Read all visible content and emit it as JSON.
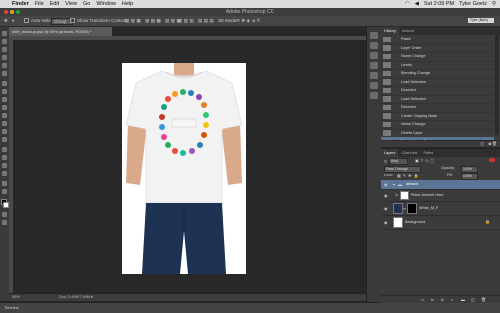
{
  "menubar": {
    "items": [
      "Finder",
      "File",
      "Edit",
      "View",
      "Go",
      "Window",
      "Help"
    ],
    "clock": "Sat 2:09 PM",
    "user": "Tyler Goelz"
  },
  "window": {
    "title": "Adobe Photoshop CC"
  },
  "options": {
    "auto_select_label": "Auto-Select:",
    "auto_select_value": "Group",
    "show_transform": "Show Transform Controls",
    "mode_3d": "3D Mode:",
    "workspace": "Tyler (Bain)"
  },
  "document": {
    "tab": "shirt_mockup.psd @ 50% (artwork, RGB/8) *",
    "zoom": "50%",
    "doc_info": "Doc: 2.40M/7.40M"
  },
  "timeline": {
    "label": "Timeline"
  },
  "history": {
    "tabs": [
      "History",
      "Actions"
    ],
    "items": [
      "Paste",
      "Layer Order",
      "Name Change",
      "Levels",
      "Blending Change",
      "Load Selection",
      "Deselect",
      "Load Selection",
      "Deselect",
      "Create Clipping Mask",
      "Name Change",
      "Delete Layer",
      "Delete Layer Mask"
    ],
    "selected_index": 12
  },
  "layers": {
    "tabs": [
      "Layers",
      "Channels",
      "Paths"
    ],
    "kind_label": "Kind",
    "blend_mode": "Pass Through",
    "opacity_label": "Opacity:",
    "opacity_value": "100%",
    "lock_label": "Lock:",
    "fill_label": "Fill:",
    "fill_value": "100%",
    "rows": [
      {
        "name": "artwork",
        "kind": "group"
      },
      {
        "name": "Place Artwork Here",
        "kind": "smart"
      },
      {
        "name": "White_M_F",
        "kind": "layer"
      },
      {
        "name": "Background",
        "kind": "background"
      }
    ]
  },
  "colors": {
    "panel_bg": "#3b3b3b",
    "canvas_bg": "#282828",
    "selection": "#5a7596",
    "shirt": "#f2f2f2",
    "jeans": "#1e3254",
    "skin": "#d9a98a"
  }
}
